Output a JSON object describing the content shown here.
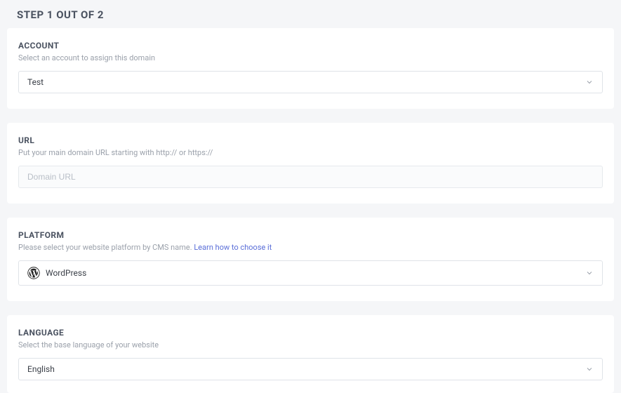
{
  "step": {
    "title": "STEP 1 OUT OF 2"
  },
  "account": {
    "label": "ACCOUNT",
    "description": "Select an account to assign this domain",
    "selected": "Test"
  },
  "url": {
    "label": "URL",
    "description": "Put your main domain URL starting with http:// or https://",
    "placeholder": "Domain URL",
    "value": ""
  },
  "platform": {
    "label": "PLATFORM",
    "description_prefix": "Please select your website platform by CMS name. ",
    "learn_link": "Learn how to choose it",
    "selected": "WordPress"
  },
  "language": {
    "label": "LANGUAGE",
    "description": "Select the base language of your website",
    "selected": "English"
  }
}
